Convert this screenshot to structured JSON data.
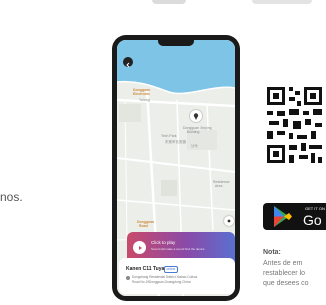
{
  "left_text": "nos.",
  "phone": {
    "map_labels": {
      "label1": "Dongguan",
      "label2": "Electronic",
      "label3": "Yulong",
      "label4": "Dongguan Xinying",
      "label5": "Building",
      "label6": "Tech Park",
      "label7": "东莞市长安镇",
      "label8": "沙头",
      "label9": "Dongguan",
      "label10": "Road",
      "label11": "Residence",
      "label12": "Area"
    },
    "play_banner": {
      "title": "Click to play",
      "subtitle": "Sound will make a sound find the device"
    },
    "device": {
      "name": "Kanen C11 Tuya",
      "badge": "online",
      "address_line1": "Dongchang Residential District Xiabao Cuibus",
      "address_line2": "Road No.19Dongguan,Guangdong China"
    }
  },
  "google_play": {
    "small": "GET IT ON",
    "big": "Go"
  },
  "note": {
    "title": "Nota:",
    "line1": "Antes de em",
    "line2": "restablecer lo",
    "line3": "que desees co"
  },
  "colors": {
    "banner_start": "#c94a6a",
    "banner_end": "#5a6fd0",
    "map_water": "#7ec4e6",
    "badge_blue": "#4a7bd0"
  }
}
